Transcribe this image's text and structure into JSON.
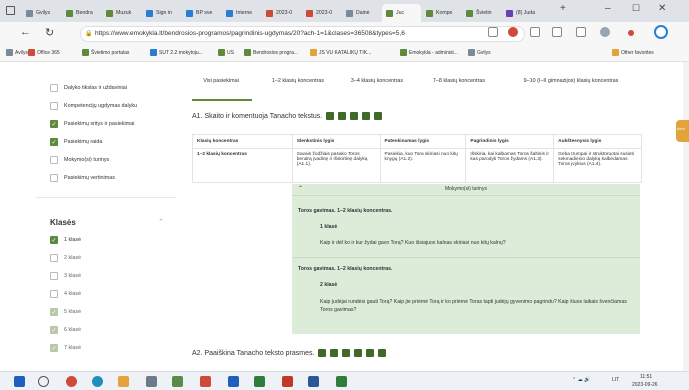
{
  "browser": {
    "tabs": [
      {
        "label": "Gvilys",
        "color": "#7a8a9a"
      },
      {
        "label": "Bendra",
        "color": "#5f8a3e"
      },
      {
        "label": "Muzuk",
        "color": "#5f8a3e"
      },
      {
        "label": "Sign in",
        "color": "#2b7cd3"
      },
      {
        "label": "BP sve",
        "color": "#2b7cd3"
      },
      {
        "label": "Interne",
        "color": "#2b7cd3"
      },
      {
        "label": "2023-0",
        "color": "#d04a3a"
      },
      {
        "label": "2023-0",
        "color": "#d04a3a"
      },
      {
        "label": "Dainė",
        "color": "#7a8a9a"
      },
      {
        "label": "Juc",
        "color": "#5f8a3e",
        "active": true
      },
      {
        "label": "Kompe",
        "color": "#5f8a3e"
      },
      {
        "label": "Švietin",
        "color": "#5f8a3e"
      },
      {
        "label": "(8) Juda",
        "color": "#6a3fb0"
      }
    ],
    "url": "https://www.emokykla.lt/bendrosios-programos/pagrindinis-ugdymas/20?ach-1=1&clases=36508&types=5,6",
    "favorites": [
      {
        "label": "Avilys",
        "color": "#7a8a9a"
      },
      {
        "label": "Office 365",
        "color": "#d04a3a"
      },
      {
        "label": "Švietimo portalas",
        "color": "#5f8a3e"
      },
      {
        "label": "SUT 2.2 mokytoju...",
        "color": "#2b7cd3"
      },
      {
        "label": "US",
        "color": "#5f8a3e"
      },
      {
        "label": "Bendrosios progra...",
        "color": "#5f8a3e"
      },
      {
        "label": "JS VU KATALIKŲ TIK...",
        "color": "#e2a43a"
      },
      {
        "label": "Emokykla - administ...",
        "color": "#5f8a3e"
      },
      {
        "label": "Gvilys",
        "color": "#7a8a9a"
      }
    ],
    "other_favorites": "Other favorites"
  },
  "sidebar": {
    "filters": [
      {
        "label": "Dalyko tikslas ir uždaviniai",
        "checked": false
      },
      {
        "label": "Kompetencijų ugdymas dalyku",
        "checked": false
      },
      {
        "label": "Pasiekimų sritys ir pasiekimai",
        "checked": true
      },
      {
        "label": "Pasiekimų raida",
        "checked": true
      },
      {
        "label": "Mokymo(si) turinys",
        "checked": false
      },
      {
        "label": "Pasiekimų vertinimas",
        "checked": false
      }
    ],
    "klases_title": "Klasės",
    "klases": [
      {
        "label": "1 klasė",
        "state": "on"
      },
      {
        "label": "2 klasė",
        "state": "off"
      },
      {
        "label": "3 klasė",
        "state": "off"
      },
      {
        "label": "4 klasė",
        "state": "off"
      },
      {
        "label": "5 klasė",
        "state": "dim"
      },
      {
        "label": "6 klasė",
        "state": "dim"
      },
      {
        "label": "7 klasė",
        "state": "dim"
      }
    ]
  },
  "main": {
    "col_tabs": [
      "Visi pasiekimai",
      "1–2 klasių koncentras",
      "3–4 klasių koncentras",
      "7–8 klasių koncentras",
      "9–10 (I–II gimnazijos) klasių koncentras"
    ],
    "a1_title": "A1. Skaito ir komentuoja Tanacho tekstus.",
    "table_headers": [
      "Klasių koncentras",
      "Slenkstinis lygis",
      "Patenkinamas lygis",
      "Pagrindinis lygis",
      "Aukštesnysis lygis"
    ],
    "table_row": [
      "1–2 klasių koncentras",
      "Savais žodžiais pasako Toros bendrą įvadinę ir išskirtinę dalyką (A1.1).",
      "Pasiekia, kuo Tora skiriasi nuo kitų knygų (A1.2).",
      "Išskiria, kai kalbamas Toros šaltinis ir kas parodyti Toros žydams (A1.3).",
      "Geba trumpai ir struktūruotai susieti sekmadienio dalyką kalbėdamas Toros įvykius (A1.4)."
    ],
    "green_header": "Mokymo(si) turinys",
    "block1_title": "Toros gavimas. 1–2 klasių koncentras.",
    "block1_class": "1 klasė",
    "block1_text": "Kaip ir dėl ko ir kur žydai gavo Torą? Kuo išsiajuos kalnas skiriasi nuo kitų kalnų?",
    "block2_title": "Toros gavimas. 1–2 klasių koncentras.",
    "block2_class": "2 klasė",
    "block2_text": "Kaip judėjai rundėsi gauti Torą? Kaip jie priėmė Torą ir ko priėmė Toras tapti judėjų gyvenimo pagrindu? Kaip šiuos laikais švenčiamas Toros gavimas?",
    "a2_title": "A2. Paaiškina Tanacho teksto prasmes.",
    "right_badge": "Iumi"
  },
  "taskbar": {
    "time": "11:51",
    "date": "2023-09-26",
    "lang": "LIT"
  }
}
